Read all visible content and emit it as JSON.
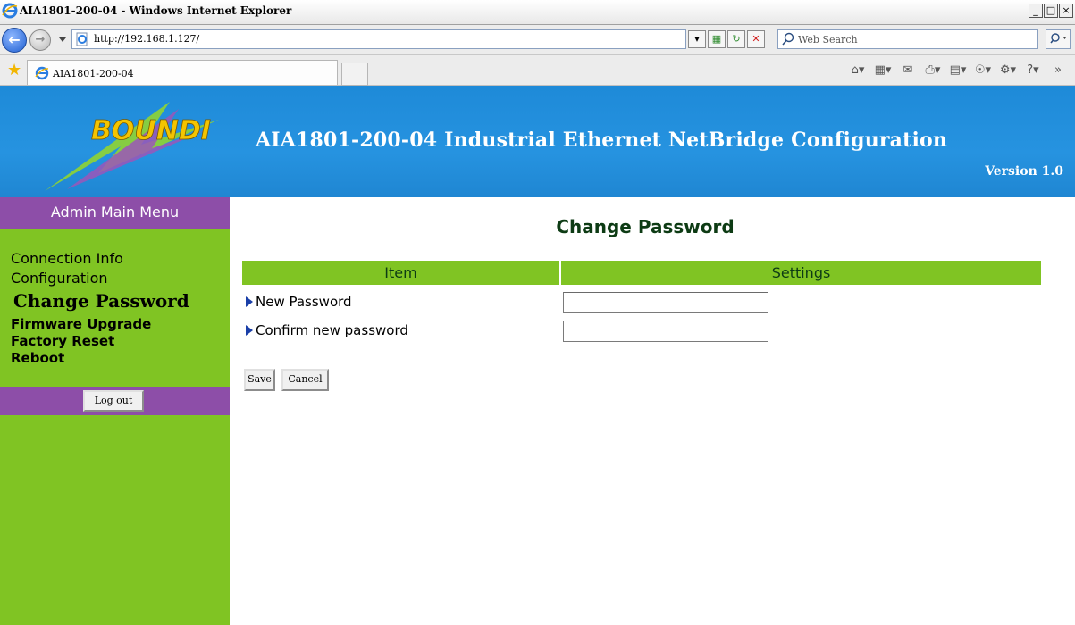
{
  "window": {
    "title": "AIA1801-200-04 - Windows Internet Explorer",
    "controls": [
      "_",
      "□",
      "×"
    ]
  },
  "browser": {
    "url": "http://192.168.1.127/",
    "search_placeholder": "Web Search",
    "tab_label": "AIA1801-200-04"
  },
  "banner": {
    "logo_text": "BOUNDI",
    "title": "AIA1801-200-04 Industrial Ethernet NetBridge Configuration",
    "version": "Version 1.0"
  },
  "sidebar": {
    "header": "Admin Main Menu",
    "items": [
      {
        "label": "Connection Info"
      },
      {
        "label": "Configuration"
      },
      {
        "label": "Change Password"
      },
      {
        "label": "Firmware Upgrade"
      },
      {
        "label": "Factory Reset"
      },
      {
        "label": "Reboot"
      }
    ],
    "logout_label": "Log out"
  },
  "main": {
    "heading": "Change Password",
    "table_headers": [
      "Item",
      "Settings"
    ],
    "rows": [
      {
        "label": "New Password",
        "value": ""
      },
      {
        "label": "Confirm new password",
        "value": ""
      }
    ],
    "buttons": {
      "save": "Save",
      "cancel": "Cancel"
    }
  },
  "colors": {
    "banner_blue": "#2693e0",
    "menu_green": "#80c423",
    "menu_purple": "#8d4ea8",
    "heading_dark_green": "#0d3b14",
    "bullet_blue": "#1a3fa8"
  }
}
